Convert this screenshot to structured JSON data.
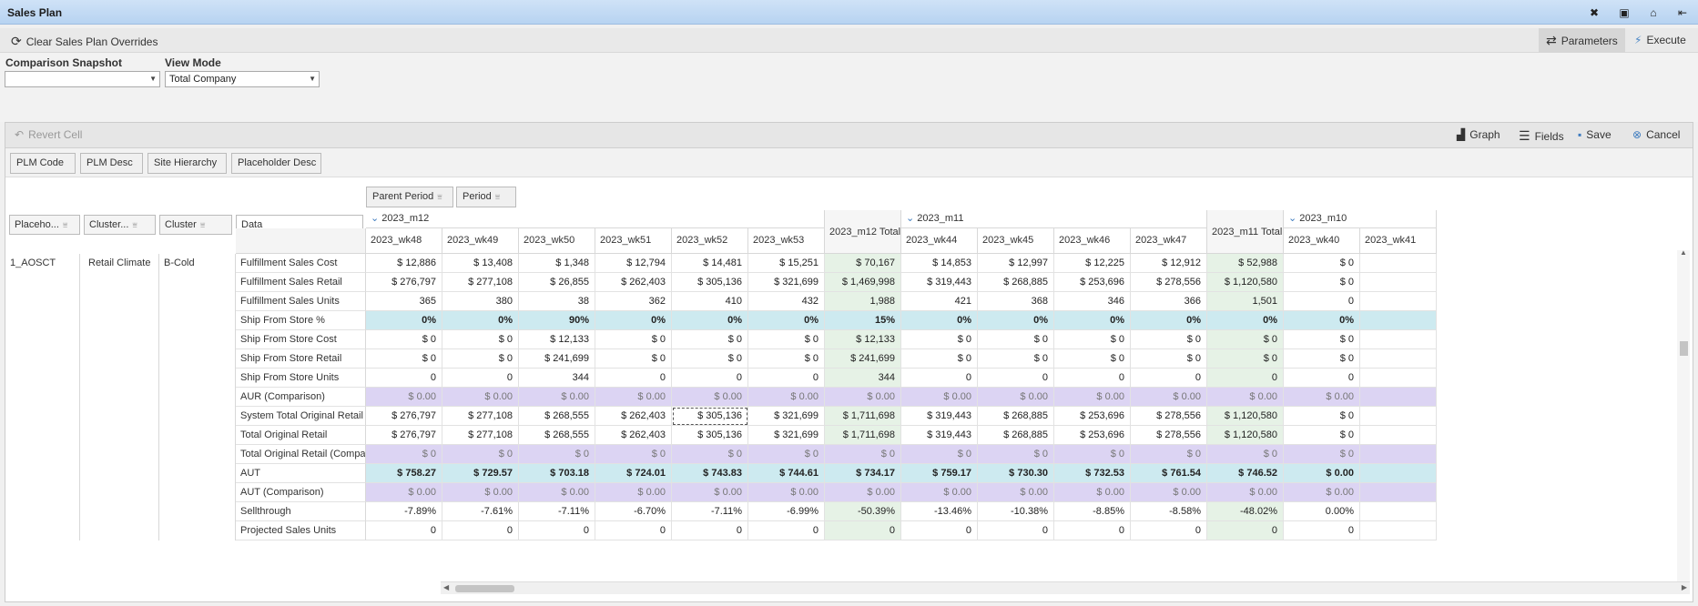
{
  "window": {
    "title": "Sales Plan",
    "buttons": [
      {
        "icon": "close-icon",
        "glyph": "✖"
      },
      {
        "icon": "layout-icon",
        "glyph": "▣"
      },
      {
        "icon": "home-icon",
        "glyph": "⌂"
      },
      {
        "icon": "pin-icon",
        "glyph": "⇤"
      }
    ]
  },
  "toolbar": {
    "clear_overrides": "Clear Sales Plan Overrides",
    "parameters": "Parameters",
    "execute": "Execute"
  },
  "params": {
    "comparison_label": "Comparison Snapshot",
    "comparison_value": "",
    "view_mode_label": "View Mode",
    "view_mode_value": "Total Company"
  },
  "grid_toolbar": {
    "revert": "Revert Cell",
    "graph": "Graph",
    "fields": "Fields",
    "save": "Save",
    "cancel": "Cancel"
  },
  "filters": [
    "PLM Code",
    "PLM Desc",
    "Site Hierarchy",
    "Placeholder Desc"
  ],
  "column_fields": [
    "Parent Period",
    "Period"
  ],
  "row_fields": [
    "Placeho...",
    "Cluster...",
    "Cluster",
    "Data"
  ],
  "row_dims": {
    "placeholder": "1_AOSCT",
    "cluster_type": "Retail Climate",
    "cluster": "B-Cold"
  },
  "groups": [
    {
      "label": "2023_m12",
      "expanded": true
    },
    {
      "label": "2023_m11",
      "expanded": true
    },
    {
      "label": "2023_m10",
      "expanded": true
    }
  ],
  "columns": [
    {
      "label": "2023_wk48",
      "total": false
    },
    {
      "label": "2023_wk49",
      "total": false
    },
    {
      "label": "2023_wk50",
      "total": false
    },
    {
      "label": "2023_wk51",
      "total": false
    },
    {
      "label": "2023_wk52",
      "total": false
    },
    {
      "label": "2023_wk53",
      "total": false
    },
    {
      "label": "2023_m12 Total",
      "total": true
    },
    {
      "label": "2023_wk44",
      "total": false
    },
    {
      "label": "2023_wk45",
      "total": false
    },
    {
      "label": "2023_wk46",
      "total": false
    },
    {
      "label": "2023_wk47",
      "total": false
    },
    {
      "label": "2023_m11 Total",
      "total": true
    },
    {
      "label": "2023_wk40",
      "total": false
    },
    {
      "label": "2023_wk41",
      "total": false
    }
  ],
  "rows": [
    {
      "label": "Fulfillment Sales Cost",
      "style": "normal",
      "values": [
        "$ 12,886",
        "$ 13,408",
        "$ 1,348",
        "$ 12,794",
        "$ 14,481",
        "$ 15,251",
        "$ 70,167",
        "$ 14,853",
        "$ 12,997",
        "$ 12,225",
        "$ 12,912",
        "$ 52,988",
        "$ 0",
        ""
      ]
    },
    {
      "label": "Fulfillment Sales Retail",
      "style": "normal",
      "values": [
        "$ 276,797",
        "$ 277,108",
        "$ 26,855",
        "$ 262,403",
        "$ 305,136",
        "$ 321,699",
        "$ 1,469,998",
        "$ 319,443",
        "$ 268,885",
        "$ 253,696",
        "$ 278,556",
        "$ 1,120,580",
        "$ 0",
        ""
      ]
    },
    {
      "label": "Fulfillment Sales Units",
      "style": "normal",
      "values": [
        "365",
        "380",
        "38",
        "362",
        "410",
        "432",
        "1,988",
        "421",
        "368",
        "346",
        "366",
        "1,501",
        "0",
        ""
      ]
    },
    {
      "label": "Ship From Store %",
      "style": "cyan",
      "values": [
        "0%",
        "0%",
        "90%",
        "0%",
        "0%",
        "0%",
        "15%",
        "0%",
        "0%",
        "0%",
        "0%",
        "0%",
        "0%",
        ""
      ]
    },
    {
      "label": "Ship From Store Cost",
      "style": "normal",
      "values": [
        "$ 0",
        "$ 0",
        "$ 12,133",
        "$ 0",
        "$ 0",
        "$ 0",
        "$ 12,133",
        "$ 0",
        "$ 0",
        "$ 0",
        "$ 0",
        "$ 0",
        "$ 0",
        ""
      ]
    },
    {
      "label": "Ship From Store Retail",
      "style": "normal",
      "values": [
        "$ 0",
        "$ 0",
        "$ 241,699",
        "$ 0",
        "$ 0",
        "$ 0",
        "$ 241,699",
        "$ 0",
        "$ 0",
        "$ 0",
        "$ 0",
        "$ 0",
        "$ 0",
        ""
      ]
    },
    {
      "label": "Ship From Store Units",
      "style": "normal",
      "values": [
        "0",
        "0",
        "344",
        "0",
        "0",
        "0",
        "344",
        "0",
        "0",
        "0",
        "0",
        "0",
        "0",
        ""
      ]
    },
    {
      "label": "AUR (Comparison)",
      "style": "lav",
      "values": [
        "$ 0.00",
        "$ 0.00",
        "$ 0.00",
        "$ 0.00",
        "$ 0.00",
        "$ 0.00",
        "$ 0.00",
        "$ 0.00",
        "$ 0.00",
        "$ 0.00",
        "$ 0.00",
        "$ 0.00",
        "$ 0.00",
        ""
      ]
    },
    {
      "label": "System Total Original Retail",
      "style": "normal",
      "values": [
        "$ 276,797",
        "$ 277,108",
        "$ 268,555",
        "$ 262,403",
        "$ 305,136",
        "$ 321,699",
        "$ 1,711,698",
        "$ 319,443",
        "$ 268,885",
        "$ 253,696",
        "$ 278,556",
        "$ 1,120,580",
        "$ 0",
        ""
      ]
    },
    {
      "label": "Total Original Retail",
      "style": "normal",
      "values": [
        "$ 276,797",
        "$ 277,108",
        "$ 268,555",
        "$ 262,403",
        "$ 305,136",
        "$ 321,699",
        "$ 1,711,698",
        "$ 319,443",
        "$ 268,885",
        "$ 253,696",
        "$ 278,556",
        "$ 1,120,580",
        "$ 0",
        ""
      ]
    },
    {
      "label": "Total Original Retail (Comparis...",
      "style": "lav",
      "values": [
        "$ 0",
        "$ 0",
        "$ 0",
        "$ 0",
        "$ 0",
        "$ 0",
        "$ 0",
        "$ 0",
        "$ 0",
        "$ 0",
        "$ 0",
        "$ 0",
        "$ 0",
        ""
      ]
    },
    {
      "label": "AUT",
      "style": "cyan",
      "values": [
        "$ 758.27",
        "$ 729.57",
        "$ 703.18",
        "$ 724.01",
        "$ 743.83",
        "$ 744.61",
        "$ 734.17",
        "$ 759.17",
        "$ 730.30",
        "$ 732.53",
        "$ 761.54",
        "$ 746.52",
        "$ 0.00",
        ""
      ]
    },
    {
      "label": "AUT (Comparison)",
      "style": "lav",
      "values": [
        "$ 0.00",
        "$ 0.00",
        "$ 0.00",
        "$ 0.00",
        "$ 0.00",
        "$ 0.00",
        "$ 0.00",
        "$ 0.00",
        "$ 0.00",
        "$ 0.00",
        "$ 0.00",
        "$ 0.00",
        "$ 0.00",
        ""
      ]
    },
    {
      "label": "Sellthrough",
      "style": "normal",
      "values": [
        "-7.89%",
        "-7.61%",
        "-7.11%",
        "-6.70%",
        "-7.11%",
        "-6.99%",
        "-50.39%",
        "-13.46%",
        "-10.38%",
        "-8.85%",
        "-8.58%",
        "-48.02%",
        "0.00%",
        ""
      ]
    },
    {
      "label": "Projected Sales Units",
      "style": "normal",
      "values": [
        "0",
        "0",
        "0",
        "0",
        "0",
        "0",
        "0",
        "0",
        "0",
        "0",
        "0",
        "0",
        "0",
        ""
      ]
    }
  ],
  "selected_cell": {
    "row": 8,
    "col": 4
  }
}
